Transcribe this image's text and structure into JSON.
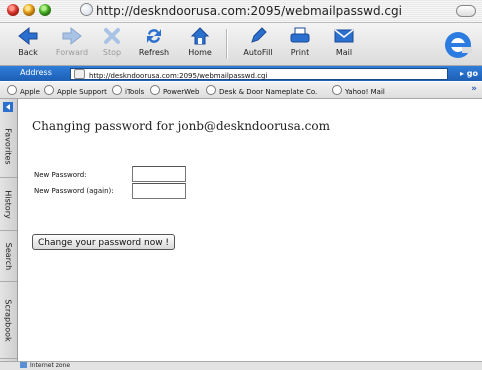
{
  "window": {
    "title": "http://deskndoorusa.com:2095/webmailpasswd.cgi"
  },
  "toolbar": {
    "back": "Back",
    "forward": "Forward",
    "stop": "Stop",
    "refresh": "Refresh",
    "home": "Home",
    "autofill": "AutoFill",
    "print": "Print",
    "mail": "Mail"
  },
  "address": {
    "label": "Address",
    "url": "http://deskndoorusa.com:2095/webmailpasswd.cgi",
    "go": "go"
  },
  "favorites": [
    "Apple",
    "Apple Support",
    "iTools",
    "PowerWeb",
    "Desk & Door Nameplate Co.",
    "Yahoo! Mail"
  ],
  "sidebar_tabs": [
    "Favorites",
    "History",
    "Search",
    "Scrapbook"
  ],
  "page": {
    "heading": "Changing password for jonb@deskndoorusa.com",
    "new_password_label": "New Password:",
    "new_password_again_label": "New Password (again):",
    "new_password_value": "",
    "new_password_again_value": "",
    "submit_label": "Change your password now !"
  },
  "status": {
    "zone": "Internet zone"
  },
  "colors": {
    "address_bar": "#2a6fcb",
    "link_blue": "#2a5db0"
  }
}
